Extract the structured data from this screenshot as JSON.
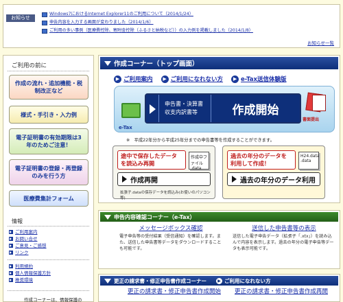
{
  "notice": {
    "badge": "お知らせ",
    "items": [
      "Windows7におけるInternet Explorer11のご利用について（2014/1/24）",
      "申告内容を入力する画面が変わりました（2014/1/6）",
      "ご利用の多い事例（医療費控除、寄附金控除（ふるさと納税など））の入力例を掲載しました（2014/1/8）"
    ],
    "more": "お知らせ一覧"
  },
  "sidebar": {
    "heading": "ご利用の前に",
    "buttons": [
      "作成の流れ・追加機能・税制改正など",
      "様式・手引き・入力例",
      "電子証明書の有効期限は3年のためご注意！",
      "電子証明書の登録・再登録のみを行う方",
      "医療費集計フォーム"
    ],
    "info_heading": "情報",
    "info_links": [
      "ご利用案内",
      "お問い合せ",
      "ご意見・ご感想",
      "リンク"
    ],
    "policy_links": [
      "利用規約",
      "個人情報保護方針",
      "推奨環境"
    ],
    "footer": "作成コーナーは、情報保護の"
  },
  "main": {
    "title": "作成コーナー（トップ画面）",
    "links": [
      "ご利用案内",
      "ご利用になれない方",
      "e-Tax送信体験版"
    ],
    "etax_label": "e-Tax",
    "create_line1": "申告書・決算書",
    "create_line2": "収支内訳書等",
    "create_big": "作成開始",
    "print_label": "書面提出",
    "note": "※　平成22年分から平成25年分までの申告書等を作成することができます。",
    "resume": {
      "label": "途中で保存したデータを読込み再開",
      "file_name": "作成中ファイル",
      "file_ext": ".data",
      "action": "作成再開",
      "caption": "拡張子.dataの保存データを読込み(お使いのパソコン等)"
    },
    "previous": {
      "label": "過去の年分のデータを利用して作成！",
      "file_name": "H24.data",
      "file_ext": ".data",
      "action": "過去の年分のデータ利用"
    }
  },
  "confirm": {
    "title": "申告内容確認コーナー（e-Tax）",
    "col1_title": "メッセージボックス確認",
    "col1_desc": "電子申告等の受付結果（受信通知）を確認します。また、送信した申告書等データをダウンロードすることも可能です。",
    "col2_title": "送信した申告書等の表示",
    "col2_desc": "送信した電子申告データ（拡張子「.xtx」）を読み込んで内容を表示します。過去の年分の電子申告等データも表示可能です。"
  },
  "amend": {
    "title": "更正の請求書・修正申告書作成コーナー",
    "link": "ご利用になれない方",
    "col1": "更正の請求書・修正申告書作成開始",
    "col2": "更正の請求書・修正申告書作成再開"
  }
}
